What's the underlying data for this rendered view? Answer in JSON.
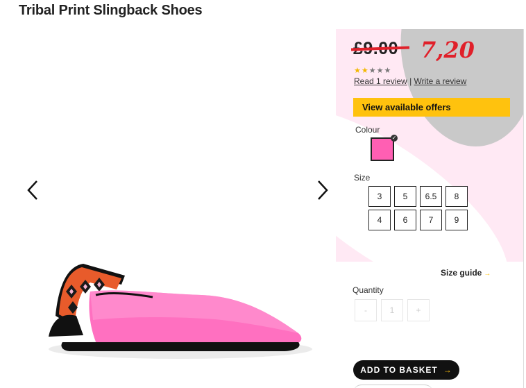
{
  "product": {
    "title": "Tribal Print Slingback Shoes"
  },
  "gallery": {
    "prev_icon": "chevron-left-icon",
    "next_icon": "chevron-right-icon"
  },
  "price": {
    "old": "£9.00",
    "new": "7,20"
  },
  "rating": {
    "value": 2,
    "max": 5,
    "read_reviews": "Read 1 review",
    "separator": "|",
    "write_review": "Write a review"
  },
  "offers_label": "View available offers",
  "colour": {
    "label": "Colour",
    "selected": "#ff5fb3"
  },
  "size": {
    "label": "Size",
    "options": [
      "3",
      "5",
      "6.5",
      "8",
      "4",
      "6",
      "7",
      "9"
    ]
  },
  "size_guide": {
    "label": "Size guide",
    "arrow": "→"
  },
  "quantity": {
    "label": "Quantity",
    "minus": "-",
    "value": "1",
    "plus": "+"
  },
  "basket": {
    "label": "ADD TO BASKET",
    "arrow": "→"
  },
  "colors": {
    "accent": "#ffc20e",
    "sale": "#e0202a",
    "shoe": "#ff5fb3"
  }
}
